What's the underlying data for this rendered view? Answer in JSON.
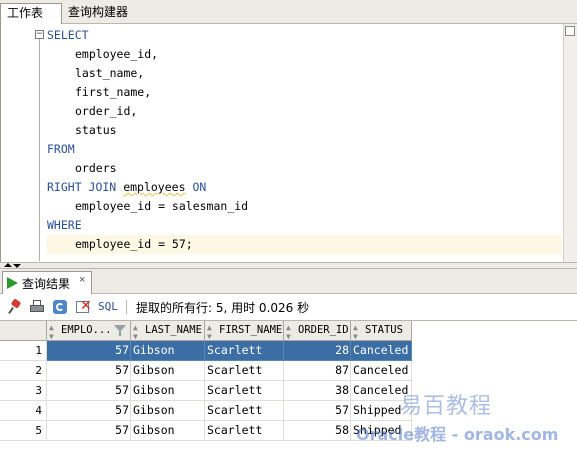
{
  "tabs": [
    "工作表",
    "查询构建器"
  ],
  "editor": {
    "fold_marker": "−",
    "lines": [
      {
        "kw": "SELECT",
        "text": ""
      },
      {
        "kw": "",
        "text": "employee_id,"
      },
      {
        "kw": "",
        "text": "last_name,"
      },
      {
        "kw": "",
        "text": "first_name,"
      },
      {
        "kw": "",
        "text": "order_id,"
      },
      {
        "kw": "",
        "text": "status"
      },
      {
        "kw": "FROM",
        "text": ""
      },
      {
        "kw": "",
        "text": "orders"
      },
      {
        "kw": "RIGHT JOIN",
        "text": "employees",
        "kw2": "ON"
      },
      {
        "kw": "",
        "text": "employee_id = salesman_id"
      },
      {
        "kw": "WHERE",
        "text": ""
      },
      {
        "kw": "",
        "text": "employee_id = 57;"
      }
    ]
  },
  "results": {
    "tab_label": "查询结果",
    "close": "×",
    "sql_link": "SQL",
    "status": "提取的所有行: 5, 用时 0.026 秒",
    "columns": [
      "EMPLO...",
      "LAST_NAME",
      "FIRST_NAME",
      "ORDER_ID",
      "STATUS"
    ],
    "rows": [
      [
        "1",
        "57",
        "Gibson",
        "Scarlett",
        "28",
        "Canceled"
      ],
      [
        "2",
        "57",
        "Gibson",
        "Scarlett",
        "87",
        "Canceled"
      ],
      [
        "3",
        "57",
        "Gibson",
        "Scarlett",
        "38",
        "Canceled"
      ],
      [
        "4",
        "57",
        "Gibson",
        "Scarlett",
        "57",
        "Shipped"
      ],
      [
        "5",
        "57",
        "Gibson",
        "Scarlett",
        "58",
        "Shipped"
      ]
    ],
    "selected_row": 0
  },
  "watermark": {
    "line1": "易百教程",
    "line2": "Oracle教程 - oraok.com"
  },
  "colors": {
    "keyword": "#2a4f9a",
    "selection": "#3a6ea5",
    "current_line": "#fdf8e3"
  }
}
